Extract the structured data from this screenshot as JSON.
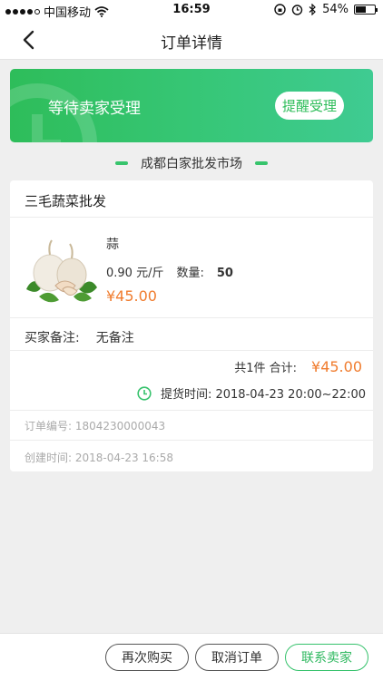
{
  "status_bar": {
    "carrier": "中国移动",
    "time": "16:59",
    "battery": "54%",
    "battery_level": 0.54
  },
  "nav": {
    "title": "订单详情"
  },
  "banner": {
    "status": "等待卖家受理",
    "remind_label": "提醒受理"
  },
  "market": {
    "name": "成都白家批发市场"
  },
  "order": {
    "seller": "三毛蔬菜批发",
    "product": {
      "name": "蒜",
      "unit_price": "0.90 元/斤",
      "qty_label": "数量:",
      "qty_value": "50",
      "subtotal": "¥45.00"
    },
    "remark_label": "买家备注:",
    "remark_value": "无备注",
    "total_count": "共1件 合计:",
    "total_amount": "¥45.00",
    "pickup_time": "提货时间: 2018-04-23 20:00~22:00",
    "order_no": "订单编号: 1804230000043",
    "created_time": "创建时间: 2018-04-23 16:58"
  },
  "actions": {
    "rebuy": "再次购买",
    "cancel": "取消订单",
    "contact": "联系卖家"
  },
  "colors": {
    "accent_green": "#2ebd5a",
    "price_orange": "#f07c2e"
  }
}
